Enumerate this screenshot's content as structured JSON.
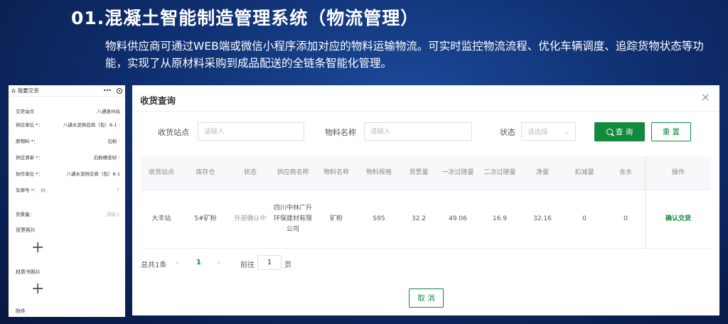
{
  "slide": {
    "title": "01.混凝土智能制造管理系统（物流管理）",
    "description": "物料供应商可通过WEB端或微信小程序添加对应的物料运输物流。可实时监控物流流程、优化车辆调度、追踪货物状态等功能，实现了从原材料采购到成品配送的全链条智能化管理。"
  },
  "phone": {
    "title": "我要交货",
    "fields": [
      {
        "label": "交货站点",
        "value": "八通泉州站",
        "arrow": ""
      },
      {
        "label": "供应单位 *：",
        "value": "八通水泥供应商（包）8-1",
        "arrow": "›"
      },
      {
        "label": "原物料 *：",
        "value": "石粉",
        "arrow": "›"
      },
      {
        "label": "供应清单 *：",
        "value": "石粉精安砂",
        "arrow": "›"
      },
      {
        "label": "协作单位 *：",
        "value": "八通水泥供应商（包）8-1",
        "arrow": ""
      },
      {
        "label": "车牌号 *：",
        "value": "川",
        "arrow": ""
      },
      {
        "label": "货票量：",
        "value": "请输入",
        "arrow": ""
      }
    ],
    "sections": {
      "ticket_photo": "货票照片",
      "material_photo": "材质书照片",
      "attachment": "附件"
    },
    "add_symbol": "+"
  },
  "modal": {
    "title": "收货查询",
    "close": "×",
    "filters": {
      "site_label": "收货站点",
      "site_placeholder": "请输入",
      "material_label": "物料名称",
      "material_placeholder": "请输入",
      "status_label": "状态",
      "status_placeholder": "请选择"
    },
    "query_label": "查 询",
    "reset_label": "重 置",
    "columns": [
      "收货站点",
      "库存仓",
      "状态",
      "供应商名称",
      "物料名称",
      "物料规格",
      "货票量",
      "一次过磅量",
      "二次过磅量",
      "净量",
      "扣减量",
      "含水",
      "操作"
    ],
    "rows": [
      [
        "大丰站",
        "5#矿粉",
        "外部确认中",
        "四川中林广升环保建材有限公司",
        "矿粉",
        "S95",
        "32.2",
        "49.06",
        "16.9",
        "32.16",
        "0",
        "0",
        "确认交货"
      ]
    ],
    "pagination": {
      "total": "总共1条",
      "prev": "‹",
      "page": "1",
      "next": "›",
      "goto": "前往",
      "goto_value": "1",
      "unit": "页"
    },
    "cancel_label": "取 消"
  },
  "colors": {
    "accent": "#118a3c",
    "background": "#0f2f70"
  }
}
